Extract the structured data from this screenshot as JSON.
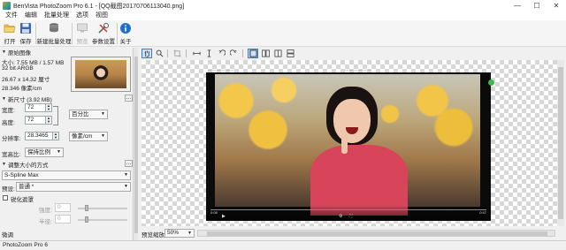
{
  "window": {
    "title": "BenVista PhotoZoom Pro 6.1 - [QQ截图20170706113040.png]",
    "controls": {
      "minimize": "—",
      "maximize": "☐",
      "close": "✕"
    }
  },
  "menu": [
    "文件",
    "编辑",
    "批量处理",
    "选项",
    "视图"
  ],
  "toolbar": {
    "open": "打开",
    "save": "保存",
    "new_batch": "新建批量处理",
    "preview": "预览",
    "settings": "参数设置",
    "about": "关于"
  },
  "left": {
    "original_header": "原始图像",
    "size_info": "大小: 7.55 MB / 1.57 MB",
    "color_depth": "32 bit ARGB",
    "dims_cm": "26.67 x 14.32 厘寸",
    "resolution": "28.346 像素/cm",
    "new_size_header": "新尺寸 (3.92 MB)",
    "width_label": "宽度:",
    "width_value": "72",
    "height_label": "高度:",
    "height_value": "72",
    "unit_percent": "百分比",
    "resolution_label": "分辨率:",
    "resolution_value": "28.3465",
    "unit_pixels": "像素/cm",
    "aspect_label": "宽高比:",
    "aspect_value": "保持比例",
    "resize_method_header": "调整大小的方式",
    "method_value": "S-Spline Max",
    "preset_label": "预设:",
    "preset_value": "普通 *",
    "unsharp_label": "锐化遮罩",
    "amount_label": "强度:",
    "amount_value": "0",
    "radius_label": "半径:",
    "radius_value": "0",
    "fine_tune_label": "微调"
  },
  "preview": {
    "zoom_label": "预览缩放:",
    "zoom_value": "50%",
    "video_time_left": "0:08",
    "video_time_right": "0:47",
    "top_mark": "— — — — — —"
  },
  "status": {
    "text": "PhotoZoom Pro 6"
  },
  "icons": {
    "open": "folder-icon",
    "save": "floppy-icon",
    "new_batch": "stack-icon",
    "preview": "monitor-icon",
    "settings": "tools-icon",
    "about": "info-icon"
  },
  "colors": {
    "accent": "#3a7bd5",
    "info": "#1e6fd0"
  }
}
